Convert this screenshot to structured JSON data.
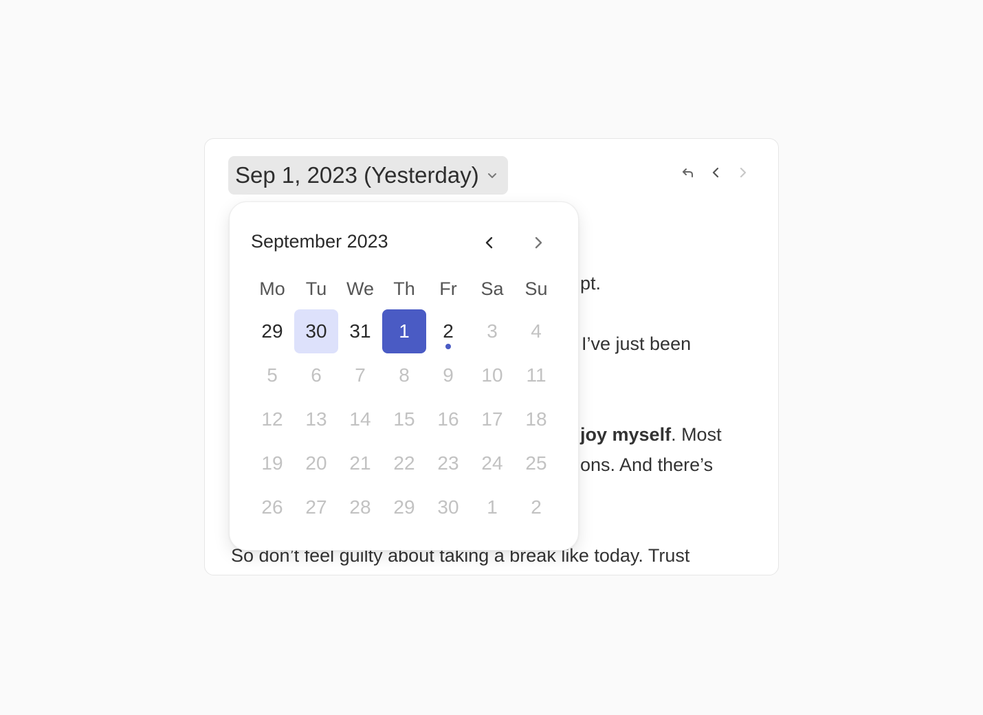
{
  "header": {
    "date_label": "Sep 1, 2023 (Yesterday)"
  },
  "toolbar": {
    "icons": [
      "return-icon",
      "chevron-left-icon",
      "chevron-right-icon"
    ]
  },
  "entry": {
    "line1": "pt.",
    "line2": "I’ve just been",
    "line3_bold": "joy myself",
    "line3_rest": ". Most",
    "line4": "ons. And there’s",
    "line5": "So don’t feel guilty about taking a break like today. Trust"
  },
  "calendar": {
    "month_title": "September 2023",
    "weekdays": [
      "Mo",
      "Tu",
      "We",
      "Th",
      "Fr",
      "Sa",
      "Su"
    ],
    "weeks": [
      [
        "29",
        "30",
        "31",
        "1",
        "2",
        "3",
        "4"
      ],
      [
        "5",
        "6",
        "7",
        "8",
        "9",
        "10",
        "11"
      ],
      [
        "12",
        "13",
        "14",
        "15",
        "16",
        "17",
        "18"
      ],
      [
        "19",
        "20",
        "21",
        "22",
        "23",
        "24",
        "25"
      ],
      [
        "26",
        "27",
        "28",
        "29",
        "30",
        "1",
        "2"
      ]
    ],
    "colors": {
      "selected": "#4a5bc4",
      "range": "#dde1fb",
      "muted": "#c2c2c2"
    }
  }
}
